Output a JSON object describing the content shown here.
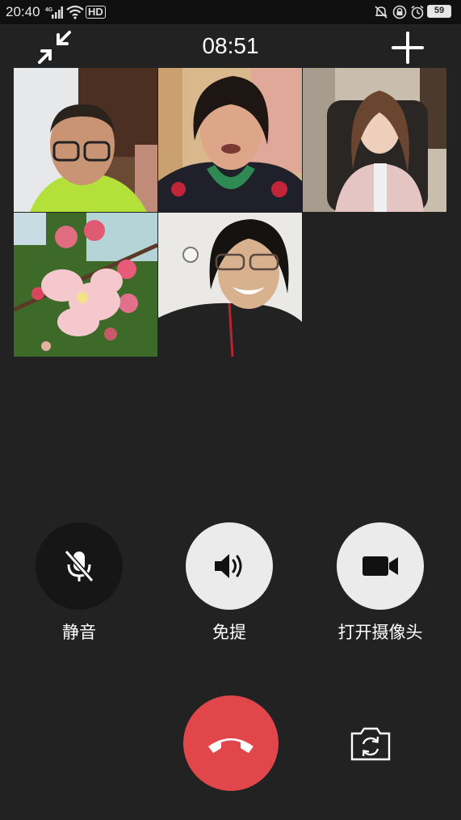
{
  "status_bar": {
    "time": "20:40",
    "network": "4G",
    "hd_badge": "HD",
    "battery": "59"
  },
  "call": {
    "timer": "08:51"
  },
  "participants": [
    {
      "id": "participant-1",
      "position": "row1-col1"
    },
    {
      "id": "participant-2",
      "position": "row1-col2"
    },
    {
      "id": "participant-3",
      "position": "row1-col3"
    },
    {
      "id": "participant-4",
      "position": "row2-col1"
    },
    {
      "id": "participant-5",
      "position": "row2-col2"
    }
  ],
  "controls": {
    "mute_label": "静音",
    "speaker_label": "免提",
    "camera_label": "打开摄像头"
  },
  "colors": {
    "background": "#222222",
    "hangup": "#e1474a",
    "button_active": "#ebebeb",
    "button_muted": "#161616"
  }
}
